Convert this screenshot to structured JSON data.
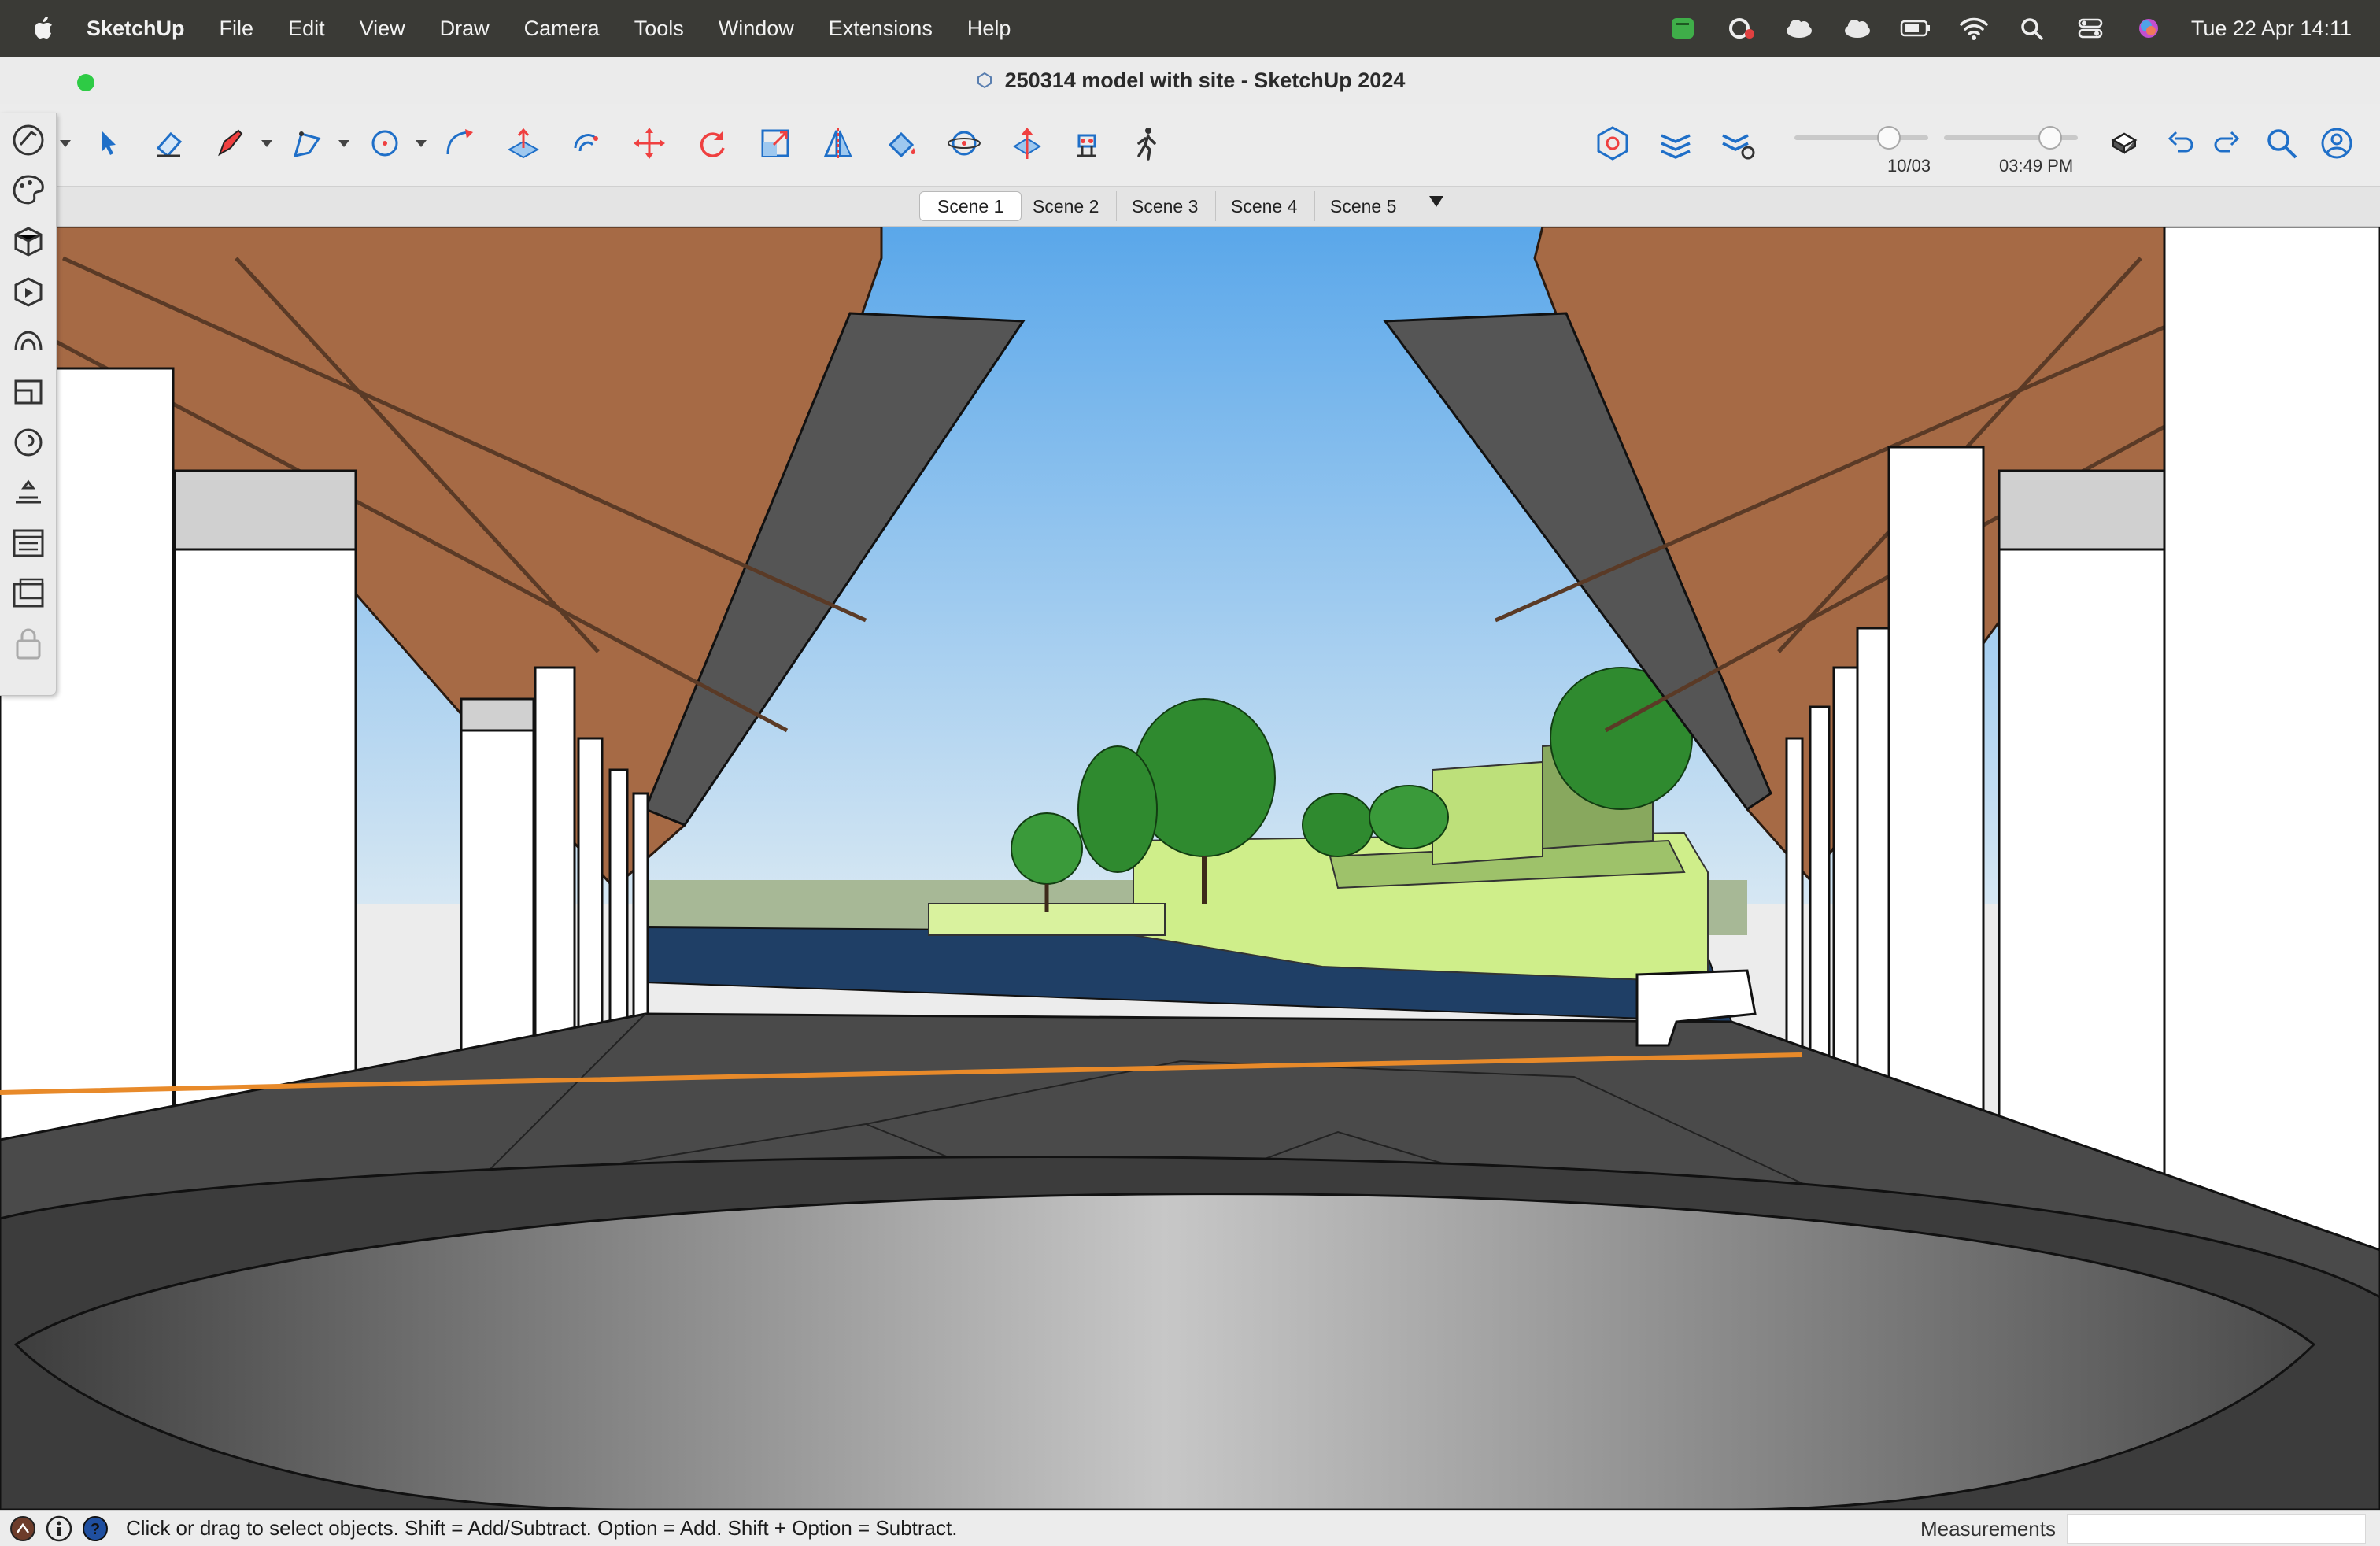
{
  "menubar": {
    "app_name": "SketchUp",
    "items": [
      "File",
      "Edit",
      "View",
      "Draw",
      "Camera",
      "Tools",
      "Window",
      "Extensions",
      "Help"
    ],
    "status_icons": [
      "evernote-icon",
      "creative-cloud-icon",
      "icloud-icon",
      "cloud-icon",
      "battery-icon",
      "wifi-icon",
      "spotlight-icon",
      "control-center-icon",
      "siri-icon"
    ],
    "clock": "Tue 22 Apr  14:11"
  },
  "window": {
    "title": "250314 model with site - SketchUp 2024"
  },
  "toolbar": {
    "tools": [
      "select-tool",
      "eraser-tool",
      "line-tool",
      "freehand-tool",
      "circle-tool",
      "arc-tool",
      "push-pull-tool",
      "offset-tool",
      "move-tool",
      "rotate-tool",
      "scale-tool",
      "flip-tool",
      "paint-bucket-tool",
      "orbit-tool",
      "position-camera-tool",
      "look-around-tool",
      "walk-tool"
    ],
    "shadow_date": "10/03",
    "shadow_time": "03:49 PM"
  },
  "scenes": {
    "tabs": [
      "Scene 1",
      "Scene 2",
      "Scene 3",
      "Scene 4",
      "Scene 5"
    ],
    "active": "Scene 1"
  },
  "statusbar": {
    "message": "Click or drag to select objects. Shift = Add/Subtract. Option = Add. Shift + Option = Subtract.",
    "measurements_label": "Measurements",
    "measurements_value": ""
  },
  "colors": {
    "sky_top": "#5aa7ea",
    "sky_bottom": "#cfe3f2",
    "timber": "#a66a45",
    "timber_dark": "#5a3a26",
    "tree_green": "#2f8a2f",
    "building_green": "#cfee8a",
    "water_blue": "#1f3f66",
    "ground_dark": "#4a4a4a",
    "section_line": "#e88a2a"
  }
}
